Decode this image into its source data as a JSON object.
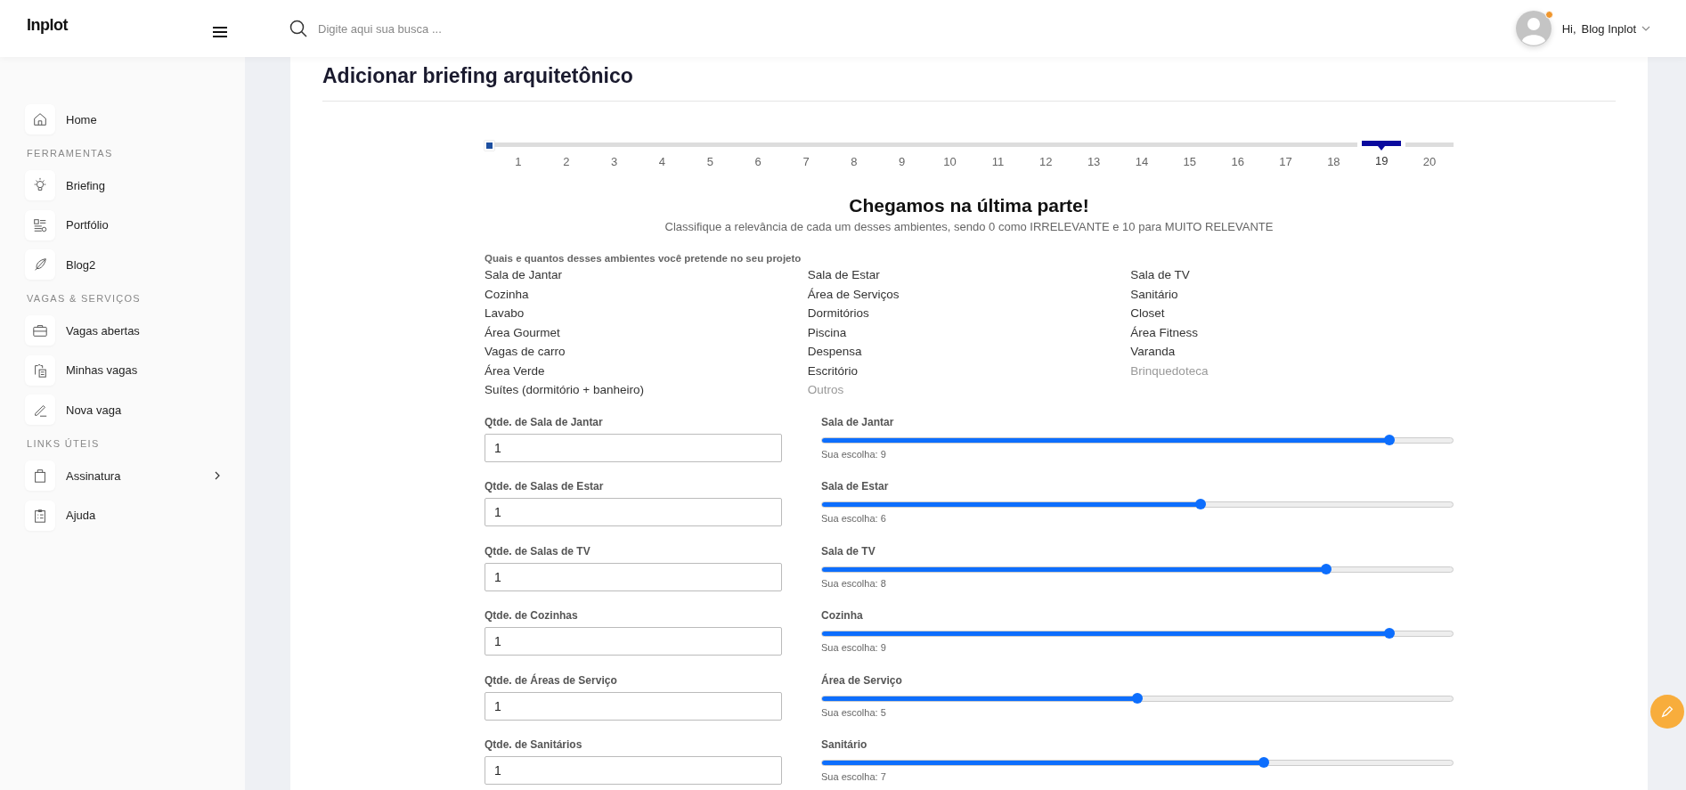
{
  "header": {
    "logo": "Inplot",
    "search": {
      "placeholder": "Digite aqui sua busca ..."
    },
    "user": {
      "greeting": "Hi,",
      "name": "Blog Inplot",
      "notification": true
    }
  },
  "sidebar": {
    "sections": [
      {
        "items": [
          {
            "label": "Home",
            "kind": "home"
          }
        ]
      },
      {
        "title": "FERRAMENTAS",
        "items": [
          {
            "label": "Briefing",
            "kind": "bulb"
          },
          {
            "label": "Portfólio",
            "kind": "portfolio"
          },
          {
            "label": "Blog2",
            "kind": "feather"
          }
        ]
      },
      {
        "title": "VAGAS & SERVIÇOS",
        "items": [
          {
            "label": "Vagas abertas",
            "kind": "briefcase"
          },
          {
            "label": "Minhas vagas",
            "kind": "copy"
          },
          {
            "label": "Nova vaga",
            "kind": "pencil"
          }
        ]
      },
      {
        "title": "LINKS ÚTEIS",
        "items": [
          {
            "label": "Assinatura",
            "kind": "bag",
            "expandable": true
          },
          {
            "label": "Ajuda",
            "kind": "checklist"
          }
        ]
      }
    ]
  },
  "page": {
    "title": "Adicionar briefing arquitetônico",
    "stepper": {
      "steps": [
        {
          "label": "1",
          "selected": false
        },
        {
          "label": "2",
          "selected": false
        },
        {
          "label": "3",
          "selected": false
        },
        {
          "label": "4",
          "selected": false
        },
        {
          "label": "5",
          "selected": false
        },
        {
          "label": "6",
          "selected": false
        },
        {
          "label": "7",
          "selected": false
        },
        {
          "label": "8",
          "selected": false
        },
        {
          "label": "9",
          "selected": false
        },
        {
          "label": "10",
          "selected": false
        },
        {
          "label": "11",
          "selected": false
        },
        {
          "label": "12",
          "selected": false
        },
        {
          "label": "13",
          "selected": false
        },
        {
          "label": "14",
          "selected": false
        },
        {
          "label": "15",
          "selected": false
        },
        {
          "label": "16",
          "selected": false
        },
        {
          "label": "17",
          "selected": false
        },
        {
          "label": "18",
          "selected": false
        },
        {
          "label": "19",
          "selected": true
        },
        {
          "label": "20",
          "selected": false
        }
      ]
    },
    "heading": "Chegamos na última parte!",
    "subtitle": "Classifique a relevância de cada um desses ambientes, sendo 0 como IRRELEVANTE e 10 para MUITO RELEVANTE",
    "rooms": {
      "label": "Quais e quantos desses ambientes você pretende no seu projeto",
      "items": [
        {
          "label": "Sala de Jantar",
          "disabled": false
        },
        {
          "label": "Sala de Estar",
          "disabled": false
        },
        {
          "label": "Sala de TV",
          "disabled": false
        },
        {
          "label": "Cozinha",
          "disabled": false
        },
        {
          "label": "Área de Serviços",
          "disabled": false
        },
        {
          "label": "Sanitário",
          "disabled": false
        },
        {
          "label": "Lavabo",
          "disabled": false
        },
        {
          "label": "Dormitórios",
          "disabled": false
        },
        {
          "label": "Closet",
          "disabled": false
        },
        {
          "label": "Área Gourmet",
          "disabled": false
        },
        {
          "label": "Piscina",
          "disabled": false
        },
        {
          "label": "Área Fitness",
          "disabled": false
        },
        {
          "label": "Vagas de carro",
          "disabled": false
        },
        {
          "label": "Despensa",
          "disabled": false
        },
        {
          "label": "Varanda",
          "disabled": false
        },
        {
          "label": "Área Verde",
          "disabled": false
        },
        {
          "label": "Escritório",
          "disabled": false
        },
        {
          "label": "Brinquedoteca",
          "disabled": true
        },
        {
          "label": "Suítes (dormitório + banheiro)",
          "disabled": false
        },
        {
          "label": "Outros",
          "disabled": true
        }
      ]
    },
    "rows": [
      {
        "qty_label": "Qtde. de Sala de Jantar",
        "qty_value": "1",
        "slider_label": "Sala de Jantar",
        "level": 0.9,
        "reading": "Sua escolha: 9"
      },
      {
        "qty_label": "Qtde. de Salas de Estar",
        "qty_value": "1",
        "slider_label": "Sala de Estar",
        "level": 0.6,
        "reading": "Sua escolha: 6"
      },
      {
        "qty_label": "Qtde. de Salas de TV",
        "qty_value": "1",
        "slider_label": "Sala de TV",
        "level": 0.8,
        "reading": "Sua escolha: 8"
      },
      {
        "qty_label": "Qtde. de Cozinhas",
        "qty_value": "1",
        "slider_label": "Cozinha",
        "level": 0.9,
        "reading": "Sua escolha: 9"
      },
      {
        "qty_label": "Qtde. de Áreas de Serviço",
        "qty_value": "1",
        "slider_label": "Área de Serviço",
        "level": 0.5,
        "reading": "Sua escolha: 5"
      },
      {
        "qty_label": "Qtde. de Sanitários",
        "qty_value": "1",
        "slider_label": "Sanitário",
        "level": 0.7,
        "reading": "Sua escolha: 7"
      }
    ]
  }
}
